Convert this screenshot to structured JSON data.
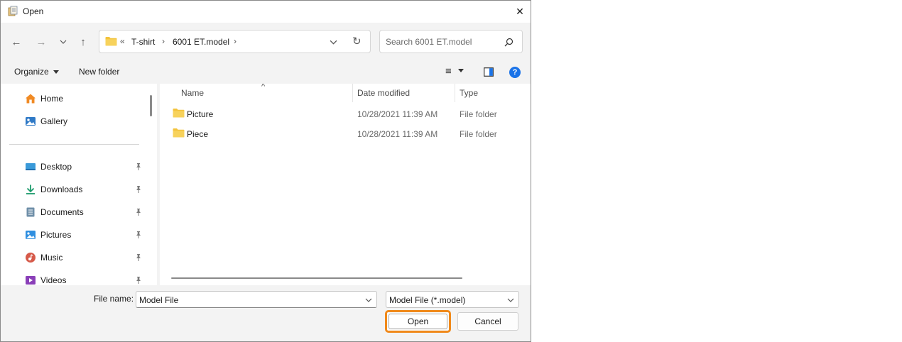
{
  "window": {
    "title": "Open",
    "close_glyph": "✕"
  },
  "colors": {
    "accent_focus": "#f0891a",
    "folder_yellow": "#f3c33c",
    "help_blue": "#1a73e8"
  },
  "navigation": {
    "back_glyph": "←",
    "forward_glyph": "→",
    "recent_glyph": "⌄",
    "up_glyph": "↑"
  },
  "address_bar": {
    "overflow": "«",
    "segments": [
      "T-shirt",
      "6001 ET.model"
    ],
    "separator": "›",
    "refresh_glyph": "↻"
  },
  "search": {
    "placeholder": "Search 6001 ET.model"
  },
  "toolbar": {
    "organize_label": "Organize",
    "new_folder_label": "New folder",
    "view_glyph": "≡",
    "help_glyph": "?"
  },
  "sidebar": {
    "quick": [
      {
        "label": "Home",
        "icon": "home-icon"
      },
      {
        "label": "Gallery",
        "icon": "gallery-icon"
      }
    ],
    "pinned": [
      {
        "label": "Desktop",
        "icon": "desktop-icon"
      },
      {
        "label": "Downloads",
        "icon": "downloads-icon"
      },
      {
        "label": "Documents",
        "icon": "documents-icon"
      },
      {
        "label": "Pictures",
        "icon": "pictures-icon"
      },
      {
        "label": "Music",
        "icon": "music-icon"
      },
      {
        "label": "Videos",
        "icon": "videos-icon"
      }
    ]
  },
  "file_list": {
    "columns": {
      "name": "Name",
      "date_modified": "Date modified",
      "type": "Type"
    },
    "sort_glyph": "^",
    "rows": [
      {
        "name": "Picture",
        "date_modified": "10/28/2021 11:39 AM",
        "type": "File folder"
      },
      {
        "name": "Piece",
        "date_modified": "10/28/2021 11:39 AM",
        "type": "File folder"
      }
    ]
  },
  "bottom": {
    "file_name_label": "File name:",
    "file_name_value": "Model File",
    "file_type_value": "Model File (*.model)",
    "open_label": "Open",
    "cancel_label": "Cancel"
  }
}
